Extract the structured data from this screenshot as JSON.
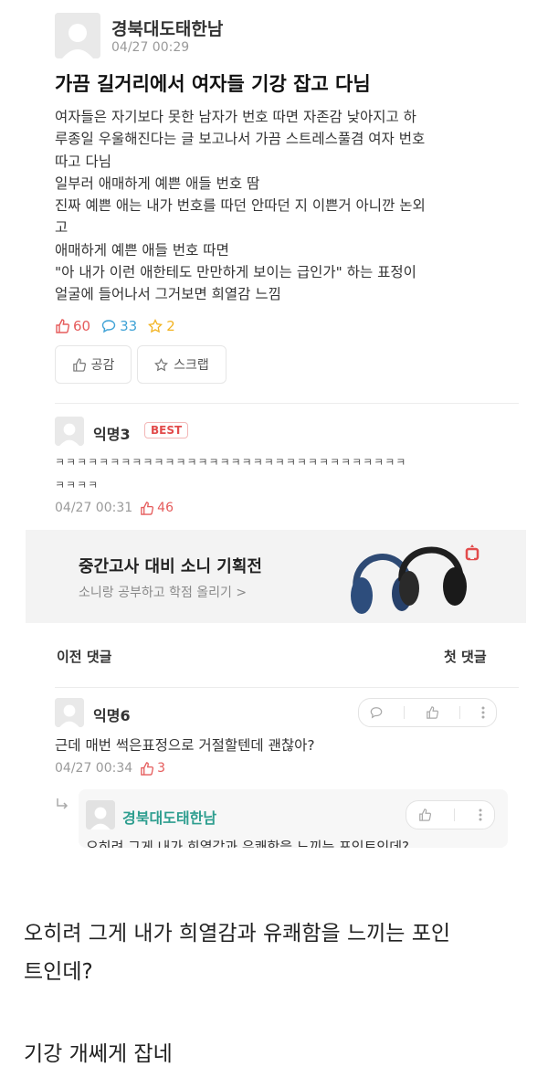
{
  "post": {
    "author": "경북대도태한남",
    "date": "04/27 00:29",
    "title": "가끔 길거리에서 여자들 기강 잡고 다님",
    "body_lines": [
      "여자들은 자기보다 못한 남자가 번호 따면 자존감 낮아지고 하",
      "루종일 우울해진다는 글 보고나서 가끔 스트레스풀겸 여자 번호",
      "따고 다님",
      "일부러 애매하게 예쁜 애들 번호 땀",
      "진짜 예쁜 애는 내가 번호를 따던 안따던 지 이쁜거 아니깐 논외",
      "고",
      "애매하게 예쁜 애들 번호 따면",
      "\"아 내가 이런 애한테도 만만하게 보이는 급인가\" 하는 표정이",
      "얼굴에 들어나서 그거보면 희열감 느낌"
    ],
    "likes": "60",
    "comments": "33",
    "scraps": "2",
    "like_button": "공감",
    "scrap_button": "스크랩"
  },
  "best_comment": {
    "author": "익명3",
    "badge": "BEST",
    "line1": "ㅋㅋㅋㅋㅋㅋㅋㅋㅋㅋㅋㅋㅋㅋㅋㅋㅋㅋㅋㅋㅋㅋㅋㅋㅋㅋㅋㅋㅋㅋㅋㅋ",
    "line2": "ㅋㅋㅋㅋ",
    "date": "04/27 00:31",
    "likes": "46"
  },
  "ad": {
    "title": "중간고사 대비 소니 기획전",
    "subtitle": "소니랑 공부하고 학점 올리기 >"
  },
  "comment_nav": {
    "prev": "이전 댓글",
    "first": "첫 댓글"
  },
  "comment2": {
    "author": "익명6",
    "text": "근데 매번 썩은표정으로 거절할텐데 괜찮아?",
    "date": "04/27 00:34",
    "likes": "3"
  },
  "reply": {
    "author": "경북대도태한남",
    "text": "오히려 그게 내가 희열감과 유쾌함을 느끼는 포인트인데?"
  },
  "caption": {
    "line1": "오히려 그게 내가 희열감과 유쾌함을 느끼는 포인",
    "line2": "트인데?",
    "line3": "기강 개쎄게 잡네"
  },
  "colors": {
    "accent_red": "#e24b4b",
    "like_red": "#e55b5b",
    "comment_blue": "#3fa2d6",
    "scrap_yellow": "#f2b321",
    "reply_author_green": "#2e9e8f"
  }
}
